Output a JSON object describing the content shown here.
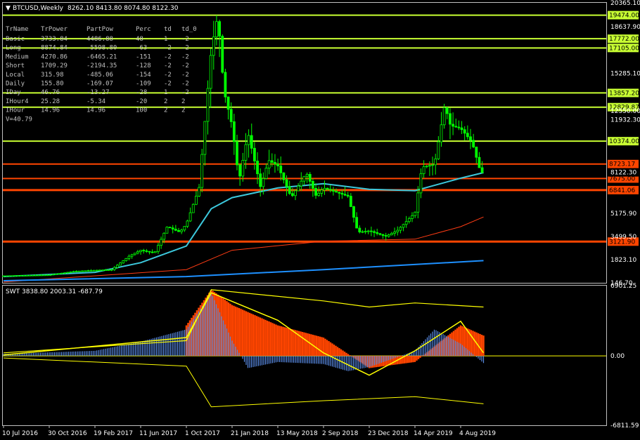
{
  "header": {
    "symbol": "BTCUSD,Weekly",
    "ohlc": "8262.10 8413.80 8074.80 8122.30"
  },
  "indicator_header": "SWT 3838.80 2003.31 -687.79",
  "table": {
    "columns": [
      "TrName",
      "TrPower",
      "PartPow",
      "Perc",
      "td",
      "td_0"
    ],
    "rows": [
      [
        "Basic",
        "3733.84",
        "4486.88",
        "48",
        "1",
        "-2"
      ],
      [
        "Long",
        "8874.84",
        "-5598.80",
        "-63",
        "-2",
        "-2"
      ],
      [
        "Medium",
        "4270.86",
        "-6465.21",
        "-151",
        "-2",
        "-2"
      ],
      [
        "Short",
        "1709.29",
        "-2194.35",
        "-128",
        "-2",
        "-2"
      ],
      [
        "Local",
        "315.98",
        "-485.06",
        "-154",
        "-2",
        "-2"
      ],
      [
        "Daily",
        "155.80",
        "-169.07",
        "-109",
        "-2",
        "-2"
      ],
      [
        "IDay",
        "46.76",
        "-13.27",
        "-28",
        "1",
        "-2"
      ],
      [
        "IHour4",
        "25.28",
        "-5.34",
        "-20",
        "2",
        "2"
      ],
      [
        "IHour",
        "14.96",
        "14.96",
        "100",
        "2",
        "2"
      ]
    ],
    "footer": "V=40.79"
  },
  "colors": {
    "background": "#000000",
    "candle": "#00ff00",
    "level_green": "#c8ff32",
    "level_orange": "#ff4500",
    "ma_cyan": "#3cc8dc",
    "ma_blue": "#1e90ff",
    "ma_red": "#ff3c14",
    "bars_blue": "#5a8ce6",
    "bars_orange": "#ff4500",
    "swt_yellow": "#ffff00"
  },
  "chart_data": [
    {
      "type": "candlestick",
      "timeframe": "Weekly",
      "ylim": [
        146.7,
        20365.1
      ],
      "y_ticks": [
        "20365.10",
        "18637.90",
        "17105.00",
        "15285.10",
        "13857.20",
        "12550.00",
        "11932.30",
        "10374.00",
        "8723.17",
        "8122.30",
        "7675.00",
        "6841.06",
        "5175.90",
        "3499.50",
        "3121.90",
        "1823.10",
        "146.70"
      ],
      "x_ticks": [
        "10 Jul 2016",
        "30 Oct 2016",
        "19 Feb 2017",
        "11 Jun 2017",
        "1 Oct 2017",
        "21 Jan 2018",
        "13 May 2018",
        "2 Sep 2018",
        "23 Dec 2018",
        "14 Apr 2019",
        "4 Aug 2019"
      ],
      "levels": [
        {
          "value": 19474.0,
          "label": "19474.00",
          "color": "#c8ff32"
        },
        {
          "value": 17772.0,
          "label": "17772.00",
          "color": "#c8ff32"
        },
        {
          "value": 17105.0,
          "label": "17105.00",
          "color": "#c8ff32"
        },
        {
          "value": 13857.2,
          "label": "13857.20",
          "color": "#c8ff32"
        },
        {
          "value": 12829.87,
          "label": "12829.87",
          "color": "#c8ff32"
        },
        {
          "value": 10374.0,
          "label": "10374.00",
          "color": "#c8ff32"
        },
        {
          "value": 8723.17,
          "label": "8723.17",
          "color": "#ff4500"
        },
        {
          "value": 7675.0,
          "label": "7675.00",
          "color": "#ff4500"
        },
        {
          "value": 6841.06,
          "label": "6841.06",
          "color": "#ff4500"
        },
        {
          "value": 3121.9,
          "label": "3121.90",
          "color": "#ff4500"
        }
      ],
      "last_price": 8122.3,
      "close_path": [
        [
          "10 Jul 2016",
          650
        ],
        [
          "30 Oct 2016",
          720
        ],
        [
          "1 Jan 2017",
          980
        ],
        [
          "19 Feb 2017",
          1050
        ],
        [
          "1 Apr 2017",
          1100
        ],
        [
          "15 May 2017",
          2100
        ],
        [
          "11 Jun 2017",
          2500
        ],
        [
          "15 Jul 2017",
          2300
        ],
        [
          "15 Aug 2017",
          4200
        ],
        [
          "15 Sep 2017",
          3800
        ],
        [
          "1 Oct 2017",
          4400
        ],
        [
          "1 Nov 2017",
          7000
        ],
        [
          "1 Dec 2017",
          17000
        ],
        [
          "17 Dec 2017",
          19474
        ],
        [
          "1 Jan 2018",
          14000
        ],
        [
          "21 Jan 2018",
          11500
        ],
        [
          "7 Feb 2018",
          7500
        ],
        [
          "1 Mar 2018",
          11000
        ],
        [
          "1 Apr 2018",
          7000
        ],
        [
          "20 Apr 2018",
          9000
        ],
        [
          "13 May 2018",
          8600
        ],
        [
          "15 Jun 2018",
          6300
        ],
        [
          "22 Jul 2018",
          8100
        ],
        [
          "15 Aug 2018",
          6400
        ],
        [
          "2 Sep 2018",
          7000
        ],
        [
          "1 Nov 2018",
          6400
        ],
        [
          "25 Nov 2018",
          3800
        ],
        [
          "23 Dec 2018",
          3900
        ],
        [
          "1 Feb 2019",
          3500
        ],
        [
          "1 Mar 2019",
          3900
        ],
        [
          "14 Apr 2019",
          5200
        ],
        [
          "1 May 2019",
          8500
        ],
        [
          "1 Jun 2019",
          8700
        ],
        [
          "26 Jun 2019",
          13000
        ],
        [
          "10 Jul 2019",
          11500
        ],
        [
          "4 Aug 2019",
          11300
        ],
        [
          "1 Sep 2019",
          10300
        ],
        [
          "22 Sep 2019",
          8100
        ],
        [
          "29 Sep 2019",
          8122.3
        ]
      ],
      "ma_fast": [
        [
          "10 Jul 2016",
          600
        ],
        [
          "19 Feb 2017",
          900
        ],
        [
          "11 Jun 2017",
          1600
        ],
        [
          "1 Oct 2017",
          2800
        ],
        [
          "1 Dec 2017",
          5500
        ],
        [
          "21 Jan 2018",
          6300
        ],
        [
          "13 May 2018",
          7000
        ],
        [
          "2 Sep 2018",
          7300
        ],
        [
          "23 Dec 2018",
          6900
        ],
        [
          "14 Apr 2019",
          6800
        ],
        [
          "4 Aug 2019",
          7700
        ],
        [
          "29 Sep 2019",
          8100
        ]
      ],
      "ma_slow": [
        [
          "10 Jul 2016",
          300
        ],
        [
          "1 Oct 2017",
          600
        ],
        [
          "2 Sep 2018",
          1100
        ],
        [
          "29 Sep 2019",
          1750
        ]
      ],
      "ma_red": [
        [
          "10 Jul 2016",
          200
        ],
        [
          "1 Oct 2017",
          1100
        ],
        [
          "21 Jan 2018",
          2500
        ],
        [
          "2 Sep 2018",
          3150
        ],
        [
          "14 Apr 2019",
          3300
        ],
        [
          "4 Aug 2019",
          4200
        ],
        [
          "29 Sep 2019",
          4900
        ]
      ]
    },
    {
      "type": "bar",
      "name": "SWT",
      "values_header": [
        3838.8,
        2003.31,
        -687.79
      ],
      "ylim": [
        -6811.59,
        6901.25
      ],
      "y_ticks": [
        "6901.25",
        "0.00",
        "-6811.59"
      ],
      "blue_bars": [
        [
          "10 Jul 2016",
          200
        ],
        [
          "19 Feb 2017",
          500
        ],
        [
          "11 Jun 2017",
          1400
        ],
        [
          "1 Oct 2017",
          2600
        ],
        [
          "1 Dec 2017",
          6200
        ],
        [
          "21 Jan 2018",
          1500
        ],
        [
          "1 Mar 2018",
          -1200
        ],
        [
          "13 May 2018",
          -600
        ],
        [
          "2 Sep 2018",
          -800
        ],
        [
          "1 Nov 2018",
          -1500
        ],
        [
          "23 Dec 2018",
          -1100
        ],
        [
          "14 Apr 2019",
          500
        ],
        [
          "1 Jun 2019",
          2600
        ],
        [
          "4 Aug 2019",
          1200
        ],
        [
          "29 Sep 2019",
          -700
        ]
      ],
      "orange_area": [
        [
          "1 Oct 2017",
          3000
        ],
        [
          "1 Dec 2017",
          6500
        ],
        [
          "21 Jan 2018",
          5000
        ],
        [
          "13 May 2018",
          3000
        ],
        [
          "2 Sep 2018",
          1800
        ],
        [
          "23 Dec 2018",
          -1200
        ],
        [
          "14 Apr 2019",
          -600
        ],
        [
          "4 Aug 2019",
          3000
        ],
        [
          "29 Sep 2019",
          2000
        ]
      ]
    }
  ]
}
